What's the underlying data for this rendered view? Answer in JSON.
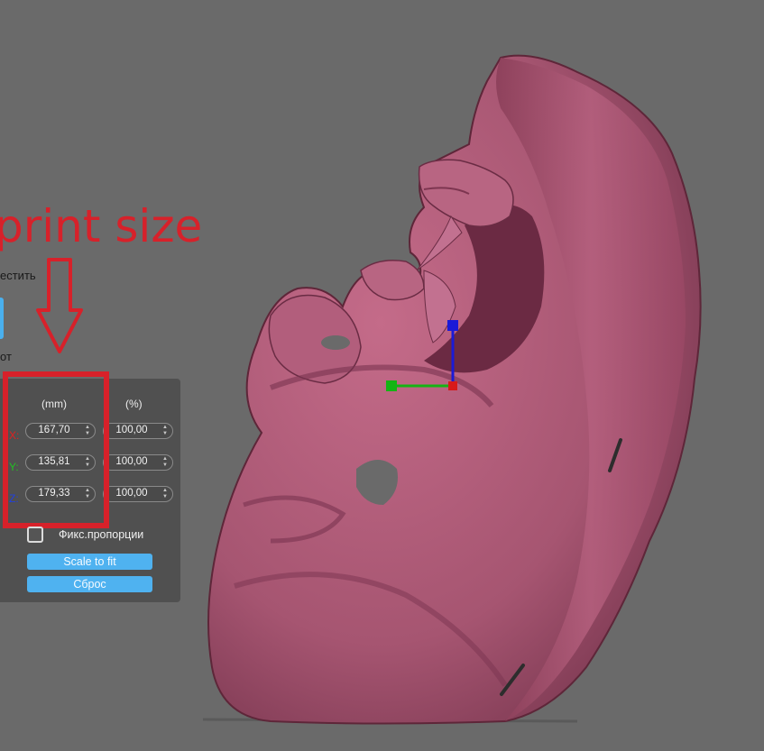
{
  "annotation": {
    "text": "print size"
  },
  "partial_labels": {
    "place": "естить",
    "rotate": "от"
  },
  "scale_panel": {
    "col_mm": "(mm)",
    "col_percent": "(%)",
    "rows": [
      {
        "axis": "X:",
        "mm": "167,70",
        "percent": "100,00",
        "color": "#e02020"
      },
      {
        "axis": "Y:",
        "mm": "135,81",
        "percent": "100,00",
        "color": "#22c022"
      },
      {
        "axis": "Z:",
        "mm": "179,33",
        "percent": "100,00",
        "color": "#2040e0"
      }
    ],
    "fix_proportions_label": "Фикс.пропорции",
    "scale_to_fit_label": "Scale to fit",
    "reset_label": "Сброс"
  },
  "colors": {
    "background": "#6a6a6a",
    "model": "#a65571",
    "accent_button": "#4fb2f0",
    "annotation_red": "#d7212a"
  },
  "icons": [
    "gizmo-axis-icon",
    "spinner-arrows-icon",
    "down-arrow-annotation-icon"
  ]
}
